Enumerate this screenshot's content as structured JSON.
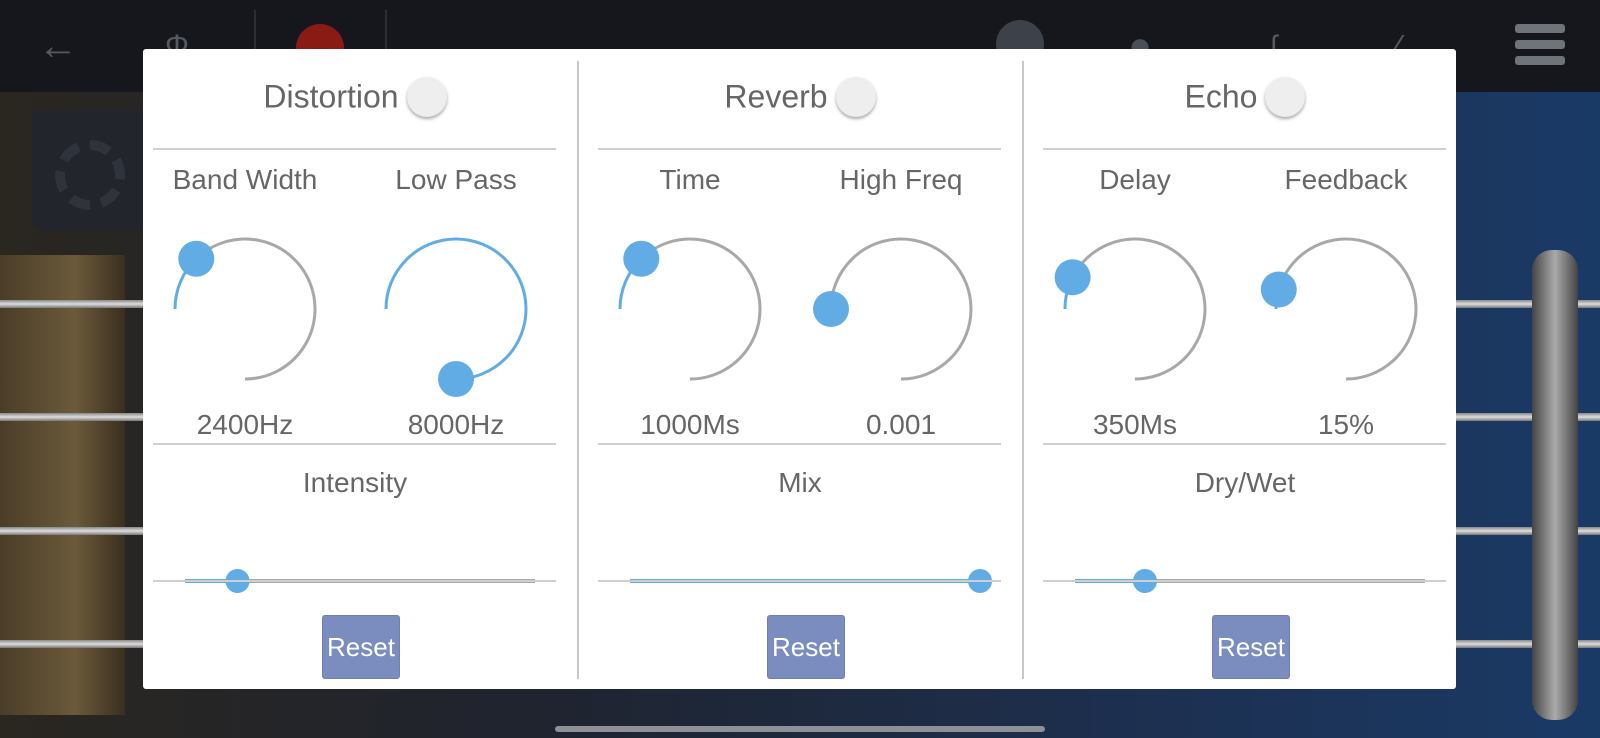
{
  "colors": {
    "accent": "#62ace6",
    "track": "#a8a8a8",
    "reset_bg": "#7b8dbf",
    "text": "#666666"
  },
  "background": {
    "icons": [
      "back-arrow-icon",
      "tuning-fork-icon",
      "record-icon",
      "fx-icon",
      "pick-icon",
      "chord-icon",
      "guitar-icon",
      "menu-icon",
      "gear-icon"
    ]
  },
  "effects": [
    {
      "title": "Distortion",
      "enabled": false,
      "knobs": [
        {
          "label": "Band Width",
          "value": "2400Hz",
          "fraction": 0.17
        },
        {
          "label": "Low Pass",
          "value": "8000Hz",
          "fraction": 1.0
        }
      ],
      "slider": {
        "label": "Intensity",
        "fraction": 0.15
      },
      "reset_label": "Reset"
    },
    {
      "title": "Reverb",
      "enabled": false,
      "knobs": [
        {
          "label": "Time",
          "value": "1000Ms",
          "fraction": 0.17
        },
        {
          "label": "High Freq",
          "value": "0.001",
          "fraction": 0.0
        }
      ],
      "slider": {
        "label": "Mix",
        "fraction": 1.0
      },
      "reset_label": "Reset"
    },
    {
      "title": "Echo",
      "enabled": false,
      "knobs": [
        {
          "label": "Delay",
          "value": "350Ms",
          "fraction": 0.1
        },
        {
          "label": "Feedback",
          "value": "15%",
          "fraction": 0.06
        }
      ],
      "slider": {
        "label": "Dry/Wet",
        "fraction": 0.2
      },
      "reset_label": "Reset"
    }
  ]
}
